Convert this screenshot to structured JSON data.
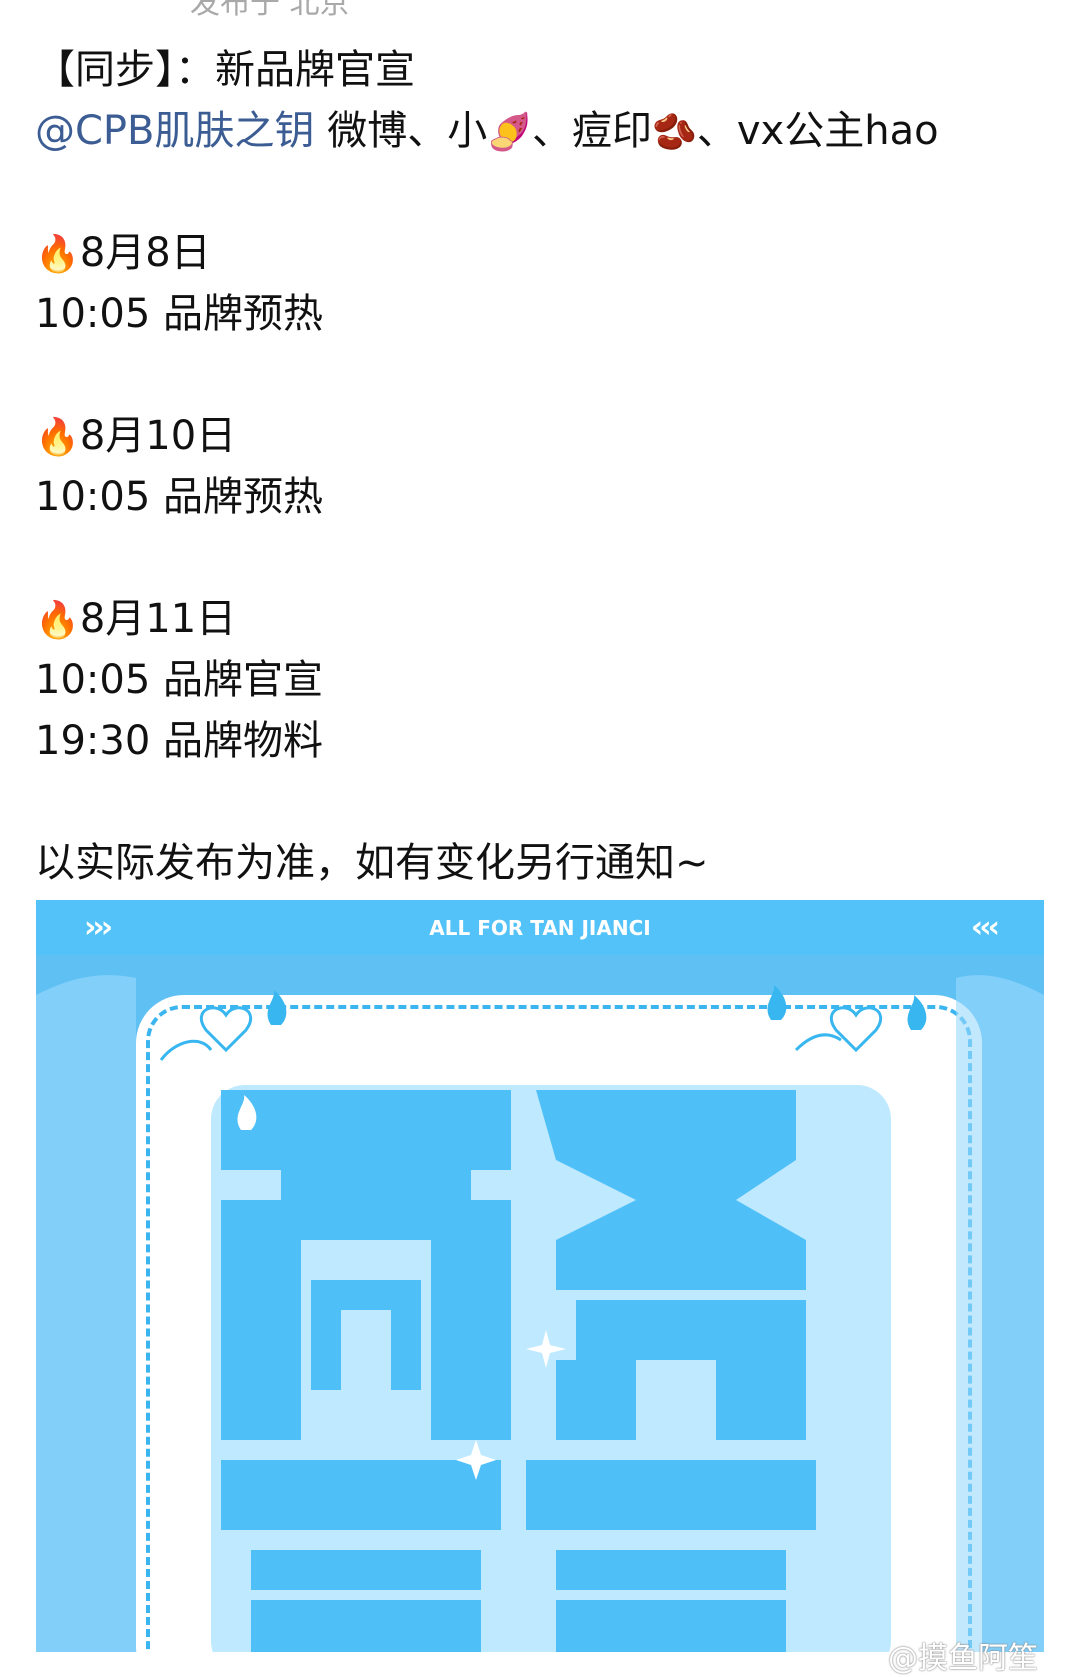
{
  "header": {
    "location_text": "发布于 北京"
  },
  "post": {
    "title_line": "【同步】：新品牌官宣",
    "mention": "@CPB肌肤之钥",
    "platforms_text": {
      "part1": " 微博、小",
      "emoji1": "🍠",
      "part2": "、痘印",
      "emoji2": "🫘",
      "part3": "、vx公主hao"
    },
    "schedule": [
      {
        "emoji": "🔥",
        "date": "8月8日",
        "items": [
          "10:05 品牌预热"
        ]
      },
      {
        "emoji": "🔥",
        "date": "8月10日",
        "items": [
          "10:05 品牌预热"
        ]
      },
      {
        "emoji": "🔥",
        "date": "8月11日",
        "items": [
          "10:05 品牌官宣",
          "19:30 品牌物料"
        ]
      }
    ],
    "footer_note": "以实际发布为准，如有变化另行通知~"
  },
  "poster": {
    "left_arrows": "›››",
    "top_banner": "ALL FOR TAN JIANCI",
    "right_arrows": "‹‹‹",
    "big_text": [
      "商务",
      "官宣"
    ],
    "colors": {
      "accent": "#4fc0f7",
      "light": "#d9f1ff",
      "white": "#ffffff"
    }
  },
  "watermark": "@摸鱼阿笙"
}
